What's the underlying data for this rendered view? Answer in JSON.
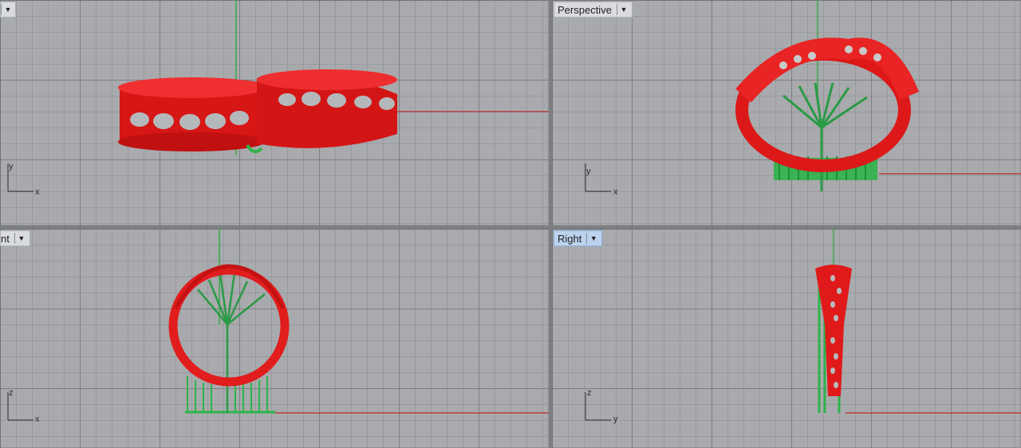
{
  "viewports": {
    "top_left": {
      "label": "",
      "axes": [
        "y",
        "x"
      ]
    },
    "top_right": {
      "label": "Perspective",
      "axes": [
        "y",
        "x"
      ]
    },
    "bottom_left": {
      "label": "nt",
      "axes": [
        "z",
        "x"
      ]
    },
    "bottom_right": {
      "label": "Right",
      "axes": [
        "z",
        "y"
      ]
    }
  },
  "colors": {
    "viewport_bg": "#a8aaad",
    "model_red": "#e01a1a",
    "support_green": "#2fb34a",
    "axis_red": "#b5403e",
    "axis_green": "#3aa64a"
  },
  "icons": {
    "menu": "dropdown-arrow-icon"
  }
}
